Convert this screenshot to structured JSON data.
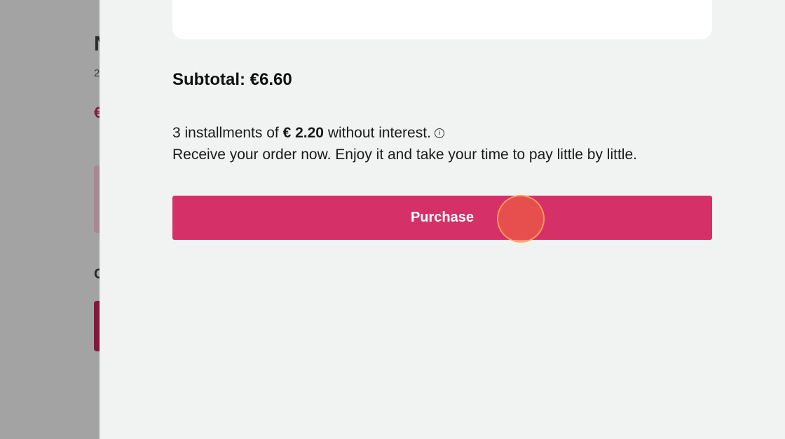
{
  "background_page": {
    "title_partial": "N",
    "subtitle_partial": "2",
    "price_partial": "€",
    "heading_partial": "C"
  },
  "drawer": {
    "subtotal": "Subtotal: €6.60",
    "installments": {
      "prefix": "3 installments of",
      "amount": "€ 2.20",
      "suffix": "without interest.",
      "info_icon": "info-icon"
    },
    "receive_text": "Receive your order now. Enjoy it and take your time to pay little by little.",
    "purchase_label": "Purchase"
  },
  "colors": {
    "accent": "#d63068",
    "drawer_bg": "#f1f3f2",
    "overlay": "#a3a3a3"
  }
}
